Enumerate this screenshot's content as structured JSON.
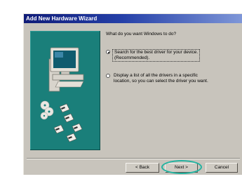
{
  "window": {
    "title": "Add New Hardware Wizard"
  },
  "main": {
    "question": "What do you want Windows to do?",
    "options": [
      {
        "line1": "Search for the best driver for your device.",
        "line2": "(Recommended).",
        "selected": true
      },
      {
        "line1": "Display a list of all the drivers in a specific",
        "line2": "location, so you can select the driver you want.",
        "selected": false
      }
    ]
  },
  "buttons": {
    "back": "< Back",
    "next": "Next >",
    "cancel": "Cancel"
  },
  "colors": {
    "title_bar": "#1a2a8c",
    "banner": "#1a7f7a",
    "dialog_bg": "#c8c4bc",
    "highlight_ring": "#23b3a0"
  },
  "icons": [
    "computer-icon",
    "cd-disc-icon",
    "floppy-disk-icon"
  ]
}
